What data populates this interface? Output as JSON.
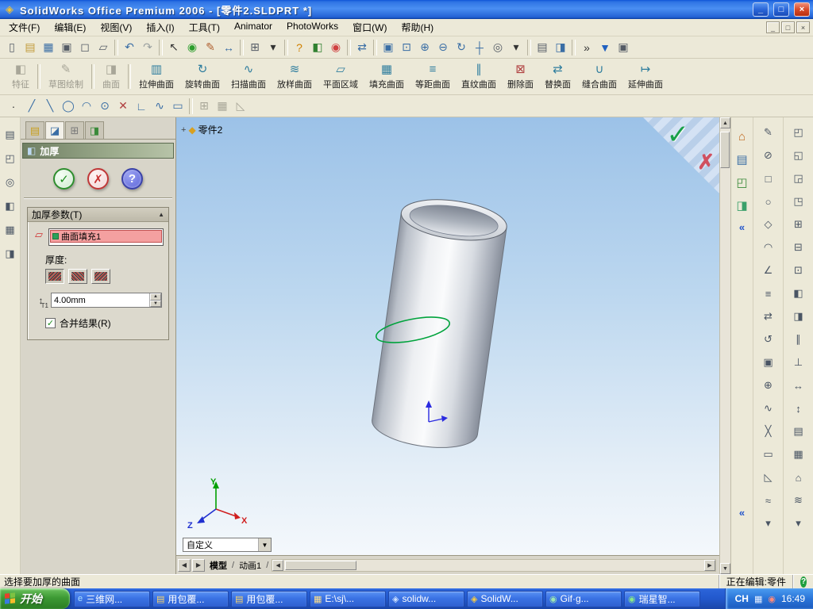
{
  "titlebar": {
    "icon": "◈",
    "title": "SolidWorks Office Premium 2006 - [零件2.SLDPRT *]",
    "controls": {
      "minimize": "_",
      "restore": "□",
      "close": "×"
    }
  },
  "menubar": {
    "items": [
      "文件(F)",
      "编辑(E)",
      "视图(V)",
      "插入(I)",
      "工具(T)",
      "Animator",
      "PhotoWorks",
      "窗口(W)",
      "帮助(H)"
    ]
  },
  "mdi": {
    "minimize": "_",
    "restore": "□",
    "close": "×"
  },
  "glyphs": {
    "up": "▲",
    "down": "▼",
    "left": "◀",
    "right": "▶",
    "dropdown": "▼",
    "collapse": "▲",
    "slash": "/",
    "chevron": "«",
    "plus": "+",
    "check": "✓"
  },
  "toolbar_standard": {
    "icons": [
      {
        "name": "new-document",
        "glyph": "▯",
        "color": "#555c66"
      },
      {
        "name": "open-folder",
        "glyph": "▤",
        "color": "#c29a3a"
      },
      {
        "name": "save",
        "glyph": "▦",
        "color": "#3a6ea5"
      },
      {
        "name": "print",
        "glyph": "▣",
        "color": "#555c66"
      },
      {
        "name": "print-preview",
        "glyph": "◻",
        "color": "#555c66"
      },
      {
        "name": "copy",
        "glyph": "▱",
        "color": "#555c66"
      },
      {
        "sep": true,
        "glyph": ""
      },
      {
        "name": "undo",
        "glyph": "↶",
        "color": "#3a6ea5"
      },
      {
        "name": "redo",
        "glyph": "↷",
        "color": "#9aa0a0"
      },
      {
        "sep": true,
        "glyph": ""
      },
      {
        "name": "select-cursor",
        "glyph": "↖",
        "color": "#333333"
      },
      {
        "name": "rebuild",
        "glyph": "◉",
        "color": "#2e9e2e"
      },
      {
        "name": "sketch-pencil",
        "glyph": "✎",
        "color": "#b06030"
      },
      {
        "name": "dimension",
        "glyph": "↔",
        "color": "#3a6ea5"
      },
      {
        "sep": true,
        "glyph": ""
      },
      {
        "name": "grid",
        "glyph": "⊞",
        "color": "#555c66"
      },
      {
        "name": "dropdown-arrow",
        "glyph": "▾",
        "color": "#333333"
      },
      {
        "sep": true,
        "glyph": ""
      },
      {
        "name": "help",
        "glyph": "?",
        "color": "#d08000"
      },
      {
        "name": "display-toggle",
        "glyph": "◧",
        "color": "#308030"
      },
      {
        "name": "lights",
        "glyph": "◉",
        "color": "#d04040"
      },
      {
        "sep": true,
        "glyph": ""
      },
      {
        "name": "swap-views",
        "glyph": "⇄",
        "color": "#3a6ea5"
      },
      {
        "sep": true,
        "glyph": ""
      },
      {
        "name": "zoom-fit",
        "glyph": "▣",
        "color": "#3a6ea5"
      },
      {
        "name": "zoom-area",
        "glyph": "⊡",
        "color": "#3a6ea5"
      },
      {
        "name": "zoom-in",
        "glyph": "⊕",
        "color": "#3a6ea5"
      },
      {
        "name": "zoom-out",
        "glyph": "⊖",
        "color": "#3a6ea5"
      },
      {
        "name": "rotate-view",
        "glyph": "↻",
        "color": "#3a6ea5"
      },
      {
        "name": "pan",
        "glyph": "┼",
        "color": "#3a6ea5"
      },
      {
        "name": "shaded-view",
        "glyph": "◎",
        "color": "#555c66"
      },
      {
        "name": "view-dropdown",
        "glyph": "▾",
        "color": "#333333"
      },
      {
        "sep": true,
        "glyph": ""
      },
      {
        "name": "standard-views",
        "glyph": "▤",
        "color": "#555c66"
      },
      {
        "name": "section-view",
        "glyph": "◨",
        "color": "#3a6ea5"
      },
      {
        "sep": true,
        "glyph": ""
      },
      {
        "name": "overflow-chevron",
        "glyph": "»",
        "color": "#333333"
      },
      {
        "name": "more-tools",
        "glyph": "▼",
        "color": "#2060c0"
      },
      {
        "name": "window-tool",
        "glyph": "▣",
        "color": "#555c66"
      }
    ]
  },
  "toolbar_surfaces": {
    "buttons": [
      {
        "label": "特征",
        "glyph": "◧",
        "grayed": true
      },
      {
        "sep": true,
        "glyph": "",
        "label": ""
      },
      {
        "label": "草图绘制",
        "glyph": "✎",
        "grayed": true
      },
      {
        "sep": true,
        "glyph": "",
        "label": ""
      },
      {
        "label": "曲面",
        "glyph": "◨",
        "grayed": true
      },
      {
        "sep": true,
        "glyph": "",
        "label": ""
      },
      {
        "label": "拉伸曲面",
        "glyph": "▥",
        "color": "#2e7d9e"
      },
      {
        "label": "旋转曲面",
        "glyph": "↻",
        "color": "#2e7d9e"
      },
      {
        "label": "扫描曲面",
        "glyph": "∿",
        "color": "#2e7d9e"
      },
      {
        "label": "放样曲面",
        "glyph": "≋",
        "color": "#2e7d9e"
      },
      {
        "label": "平面区域",
        "glyph": "▱",
        "color": "#2e7d9e"
      },
      {
        "label": "填充曲面",
        "glyph": "▦",
        "color": "#2e7d9e"
      },
      {
        "label": "等距曲面",
        "glyph": "≡",
        "color": "#2e7d9e"
      },
      {
        "label": "直纹曲面",
        "glyph": "∥",
        "color": "#2e7d9e"
      },
      {
        "label": "删除面",
        "glyph": "⊠",
        "color": "#b04040"
      },
      {
        "label": "替换面",
        "glyph": "⇄",
        "color": "#2e7d9e"
      },
      {
        "label": "缝合曲面",
        "glyph": "∪",
        "color": "#2e7d9e"
      },
      {
        "label": "延伸曲面",
        "glyph": "↦",
        "color": "#2e7d9e"
      }
    ]
  },
  "toolbar_sketch": {
    "icons": [
      {
        "name": "point",
        "glyph": "·",
        "color": "#333333"
      },
      {
        "name": "line",
        "glyph": "╱",
        "color": "#3a6ea5"
      },
      {
        "name": "centerline",
        "glyph": "╲",
        "color": "#3a6ea5"
      },
      {
        "name": "circle",
        "glyph": "◯",
        "color": "#3a6ea5"
      },
      {
        "name": "arc",
        "glyph": "◠",
        "color": "#3a6ea5"
      },
      {
        "name": "ellipse",
        "glyph": "⊙",
        "color": "#3a6ea5"
      },
      {
        "name": "trim",
        "glyph": "✕",
        "color": "#b04040"
      },
      {
        "name": "fillet",
        "glyph": "∟",
        "color": "#3a6ea5"
      },
      {
        "name": "spline",
        "glyph": "∿",
        "color": "#3a6ea5"
      },
      {
        "name": "rectangle",
        "glyph": "▭",
        "color": "#3a6ea5"
      },
      {
        "sep": true,
        "glyph": ""
      },
      {
        "name": "mirror",
        "glyph": "⊞",
        "grayed": true
      },
      {
        "name": "pattern",
        "glyph": "▦",
        "grayed": true
      },
      {
        "name": "chamfer",
        "glyph": "◺",
        "grayed": true
      }
    ]
  },
  "left_strip": {
    "icons": [
      {
        "name": "view-orientation",
        "glyph": "▤"
      },
      {
        "name": "display-style",
        "glyph": "◰"
      },
      {
        "name": "hide-show-items",
        "glyph": "◎"
      },
      {
        "name": "appearance",
        "glyph": "◧"
      },
      {
        "name": "scene",
        "glyph": "▦"
      },
      {
        "name": "section-tool",
        "glyph": "◨"
      }
    ]
  },
  "property_manager": {
    "tabs": [
      {
        "name": "featuremanager-tab",
        "glyph": "▤"
      },
      {
        "name": "propertymanager-tab",
        "glyph": "◪"
      },
      {
        "name": "configurationmanager-tab",
        "glyph": "⊞"
      },
      {
        "name": "dimxpert-tab",
        "glyph": "◨"
      }
    ],
    "icon": "◧",
    "title": "加厚",
    "ok": "✓",
    "cancel": "✗",
    "help": "?",
    "group": {
      "header": "加厚参数(T)",
      "selection_value": "曲面填充1",
      "thickness_label": "厚度:",
      "thickness_value": "4.00mm",
      "spin_icon_label": "T1",
      "merge_label": "合并结果(R)"
    }
  },
  "viewport": {
    "tree_label": "零件2",
    "tree_icon": "◆",
    "confirm": {
      "ok": "✓",
      "cancel": "✗"
    },
    "triad": {
      "x": "X",
      "y": "Y",
      "z": "Z"
    },
    "config_dropdown": "自定义",
    "tabs": {
      "model": "模型",
      "motion": "动画1"
    }
  },
  "task_pane": {
    "icons": [
      {
        "name": "home-icon",
        "glyph": "⌂"
      },
      {
        "name": "design-library-icon",
        "glyph": "▤"
      },
      {
        "name": "file-explorer-icon",
        "glyph": "◰"
      },
      {
        "name": "view-palette-icon",
        "glyph": "◨"
      }
    ],
    "collapse": "«"
  },
  "right_toolbars": {
    "col1": [
      {
        "name": "note-tool",
        "glyph": "✎"
      },
      {
        "name": "no-insert",
        "glyph": "⊘"
      },
      {
        "name": "rectangle-tool",
        "glyph": "□"
      },
      {
        "name": "circle-tool",
        "glyph": "○"
      },
      {
        "name": "diamond-tool",
        "glyph": "◇"
      },
      {
        "name": "arc-tool",
        "glyph": "◠"
      },
      {
        "name": "angle-tool",
        "glyph": "∠"
      },
      {
        "name": "list-tool",
        "glyph": "≡"
      },
      {
        "name": "swap-tool",
        "glyph": "⇄"
      },
      {
        "name": "undo-tool",
        "glyph": "↺"
      },
      {
        "name": "frame-tool",
        "glyph": "▣"
      },
      {
        "name": "add-tool",
        "glyph": "⊕"
      },
      {
        "name": "spline-tool",
        "glyph": "∿"
      },
      {
        "name": "cross-tool",
        "glyph": "╳"
      },
      {
        "name": "rect-tool",
        "glyph": "▭"
      },
      {
        "name": "triangle-tool",
        "glyph": "◺"
      },
      {
        "name": "wave-tool",
        "glyph": "≈"
      },
      {
        "name": "more-arrow",
        "glyph": "▾"
      }
    ],
    "col2": [
      {
        "name": "corner-tl",
        "glyph": "◰"
      },
      {
        "name": "corner-bl",
        "glyph": "◱"
      },
      {
        "name": "corner-br",
        "glyph": "◲"
      },
      {
        "name": "corner-tr",
        "glyph": "◳"
      },
      {
        "name": "grid-plus",
        "glyph": "⊞"
      },
      {
        "name": "grid-minus",
        "glyph": "⊟"
      },
      {
        "name": "box-dot",
        "glyph": "⊡"
      },
      {
        "name": "half-left",
        "glyph": "◧"
      },
      {
        "name": "half-right",
        "glyph": "◨"
      },
      {
        "name": "parallel-tool",
        "glyph": "∥"
      },
      {
        "name": "perpendicular-tool",
        "glyph": "⊥"
      },
      {
        "name": "horizontal-tool",
        "glyph": "↔"
      },
      {
        "name": "vertical-tool",
        "glyph": "↕"
      },
      {
        "name": "sheet-tool",
        "glyph": "▤"
      },
      {
        "name": "table-tool",
        "glyph": "▦"
      },
      {
        "name": "home-tool",
        "glyph": "⌂"
      },
      {
        "name": "approx-tool",
        "glyph": "≋"
      },
      {
        "name": "more-arrow",
        "glyph": "▾"
      }
    ]
  },
  "statusbar": {
    "left": "选择要加厚的曲面",
    "editing": "正在编辑:零件",
    "help": "?"
  },
  "taskbar": {
    "start": "开始",
    "tasks": [
      {
        "label": "三维网...",
        "glyph": "e",
        "color": "#aee2ff"
      },
      {
        "label": "用包覆...",
        "glyph": "▤",
        "color": "#ffd86a"
      },
      {
        "label": "用包覆...",
        "glyph": "▤",
        "color": "#ffd86a"
      },
      {
        "label": "E:\\sj\\...",
        "glyph": "▦",
        "color": "#ffe08a"
      },
      {
        "label": "solidw...",
        "glyph": "◈",
        "color": "#cfe2ff"
      },
      {
        "label": "SolidW...",
        "glyph": "◈",
        "color": "#ffd040"
      },
      {
        "label": "Gif·g...",
        "glyph": "◉",
        "color": "#9fe8b0"
      },
      {
        "label": "瑞星智...",
        "glyph": "◉",
        "color": "#88e888"
      }
    ],
    "tray": {
      "lang": "CH",
      "icons": [
        {
          "name": "input-method-tray-icon",
          "glyph": "▦"
        },
        {
          "name": "antivirus-tray-icon",
          "glyph": "◉"
        }
      ],
      "time": "16:49"
    }
  },
  "colors": {
    "titlebar_blue": "#2262d4",
    "taskbar_blue": "#2258cc",
    "start_green": "#3d9a34",
    "viewport_gradient_top": "#9cc2e8",
    "viewport_gradient_bottom": "#f4f8fc",
    "selection_highlight": "#f4a0a0",
    "sketch_green": "#00a33c",
    "pm_header_olive": "#8a9a7a"
  }
}
